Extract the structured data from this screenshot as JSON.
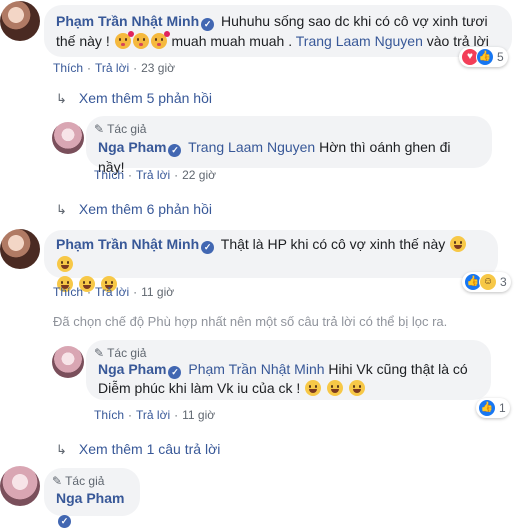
{
  "comments": {
    "c1": {
      "name": "Phạm Trần Nhật Minh",
      "text_a": "Huhuhu sống sao dc khi có cô vợ xinh tươi",
      "text_b": "thế này !",
      "text_c": "muah muah muah .",
      "mention": "Trang Laam Nguyen",
      "text_d": "vào trả lời",
      "reaction_count": "5",
      "like": "Thích",
      "reply": "Trả lời",
      "time": "23 giờ"
    },
    "more1": "Xem thêm 5 phản hồi",
    "r1": {
      "author_tag": "Tác giả",
      "name": "Nga Pham",
      "mention": "Trang Laam Nguyen",
      "text": "Hờn thì oánh ghen đi nầy!",
      "like": "Thích",
      "reply": "Trả lời",
      "time": "22 giờ"
    },
    "more2": "Xem thêm 6 phản hồi",
    "c2": {
      "name": "Phạm Trần Nhật Minh",
      "text": "Thật là HP khi có cô vợ xinh thế này",
      "reaction_count": "3",
      "like": "Thích",
      "reply": "Trả lời",
      "time": "11 giờ"
    },
    "notice": "Đã chọn chế độ Phù hợp nhất nên một số câu trả lời có thể bị lọc ra.",
    "r2": {
      "author_tag": "Tác giả",
      "name": "Nga Pham",
      "mention": "Phạm Trần Nhật Minh",
      "text_a": "Hihi Vk cũng thật là có",
      "text_b": "Diễm phúc khi làm Vk iu của ck !",
      "reaction_count": "1",
      "like": "Thích",
      "reply": "Trả lời",
      "time": "11 giờ"
    },
    "more3": "Xem thêm 1 câu trả lời",
    "c3": {
      "author_tag": "Tác giả",
      "name": "Nga Pham"
    }
  },
  "colors": {
    "link": "#385898",
    "bubble": "#f2f3f5",
    "meta": "#606770",
    "like_blue": "#1877f2",
    "love_red": "#f33e58"
  },
  "icons": {
    "verified": "verified-badge-icon",
    "reply_arrow": "reply-arrow-icon",
    "author": "pen-icon"
  }
}
